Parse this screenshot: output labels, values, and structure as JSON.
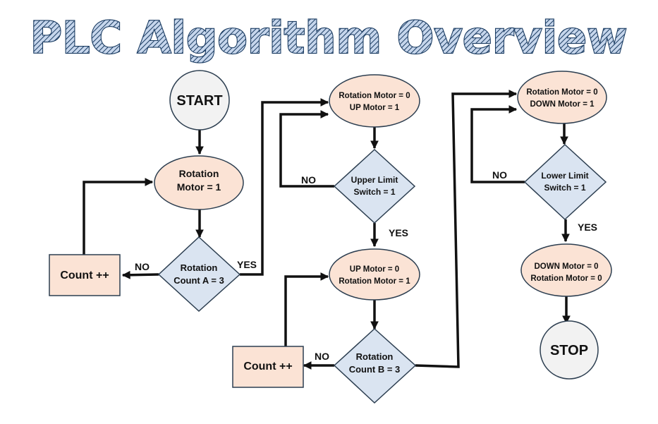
{
  "title": "PLC Algorithm Overview",
  "colors": {
    "title_fill": "#c6d6ec",
    "title_stroke": "#1c3d63",
    "terminal_fill": "#f2f2f2",
    "process_fill": "#fbe3d5",
    "decision_fill": "#dae4f1",
    "box_fill": "#fbe3d5",
    "stroke": "#111111"
  },
  "nodes": {
    "start": {
      "lines": [
        "START"
      ]
    },
    "rotation_motor_1": {
      "lines": [
        "Rotation",
        "Motor = 1"
      ]
    },
    "rotation_count_a": {
      "lines": [
        "Rotation",
        "Count A = 3"
      ]
    },
    "count_a": {
      "lines": [
        "Count ++"
      ]
    },
    "rot0_up1": {
      "lines": [
        "Rotation Motor = 0",
        "UP Motor = 1"
      ]
    },
    "upper_limit": {
      "lines": [
        "Upper Limit",
        "Switch = 1"
      ]
    },
    "up0_rot1": {
      "lines": [
        "UP Motor = 0",
        "Rotation Motor = 1"
      ]
    },
    "rotation_count_b": {
      "lines": [
        "Rotation",
        "Count B = 3"
      ]
    },
    "count_b": {
      "lines": [
        "Count ++"
      ]
    },
    "rot0_down1": {
      "lines": [
        "Rotation Motor = 0",
        "DOWN Motor = 1"
      ]
    },
    "lower_limit": {
      "lines": [
        "Lower Limit",
        "Switch = 1"
      ]
    },
    "down0_rot0": {
      "lines": [
        "DOWN Motor = 0",
        "Rotation Motor = 0"
      ]
    },
    "stop": {
      "lines": [
        "STOP"
      ]
    }
  },
  "edge_labels": {
    "count_a_no": "NO",
    "count_a_yes": "YES",
    "upper_no": "NO",
    "upper_yes": "YES",
    "count_b_no": "NO",
    "lower_no": "NO",
    "lower_yes": "YES"
  }
}
